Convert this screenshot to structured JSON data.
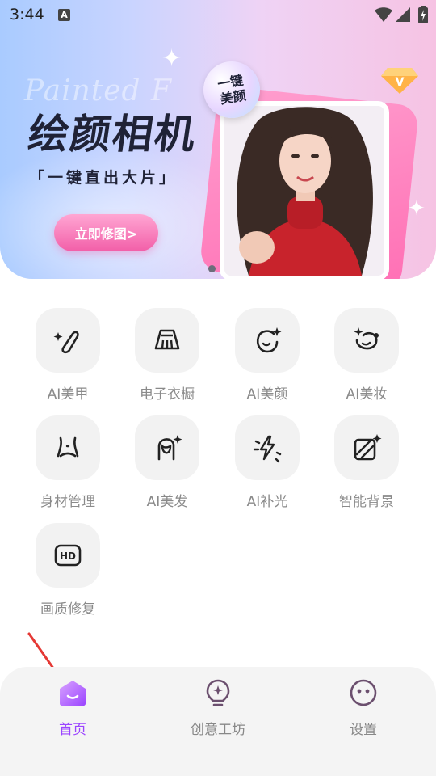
{
  "status_bar": {
    "time": "3:44",
    "notification_icon": "A",
    "icons": [
      "wifi-icon",
      "signal-icon",
      "battery-charging-icon"
    ]
  },
  "banner": {
    "watermark": "Painted F",
    "title": "绘颜相机",
    "subtitle": "「一键直出大片」",
    "cta_label": "立即修图>",
    "badge_text": "一键美颜",
    "vip_icon": "vip-diamond-icon",
    "colors": {
      "accent": "#f25fa8",
      "frame": "#ff6fb4"
    }
  },
  "features": [
    {
      "label": "AI美甲",
      "icon": "nail-polish-icon"
    },
    {
      "label": "电子衣橱",
      "icon": "skirt-icon"
    },
    {
      "label": "AI美颜",
      "icon": "face-sparkle-icon"
    },
    {
      "label": "AI美妆",
      "icon": "makeup-icon"
    },
    {
      "label": "身材管理",
      "icon": "body-shape-icon"
    },
    {
      "label": "AI美发",
      "icon": "hair-icon"
    },
    {
      "label": "AI补光",
      "icon": "fill-light-icon"
    },
    {
      "label": "智能背景",
      "icon": "background-icon"
    },
    {
      "label": "画质修复",
      "icon": "hd-icon"
    }
  ],
  "bottom_nav": {
    "items": [
      {
        "label": "首页",
        "icon": "home-icon",
        "active": true
      },
      {
        "label": "创意工坊",
        "icon": "lightbulb-icon",
        "active": false
      },
      {
        "label": "设置",
        "icon": "settings-face-icon",
        "active": false
      }
    ],
    "active_color": "#9b45ff"
  }
}
